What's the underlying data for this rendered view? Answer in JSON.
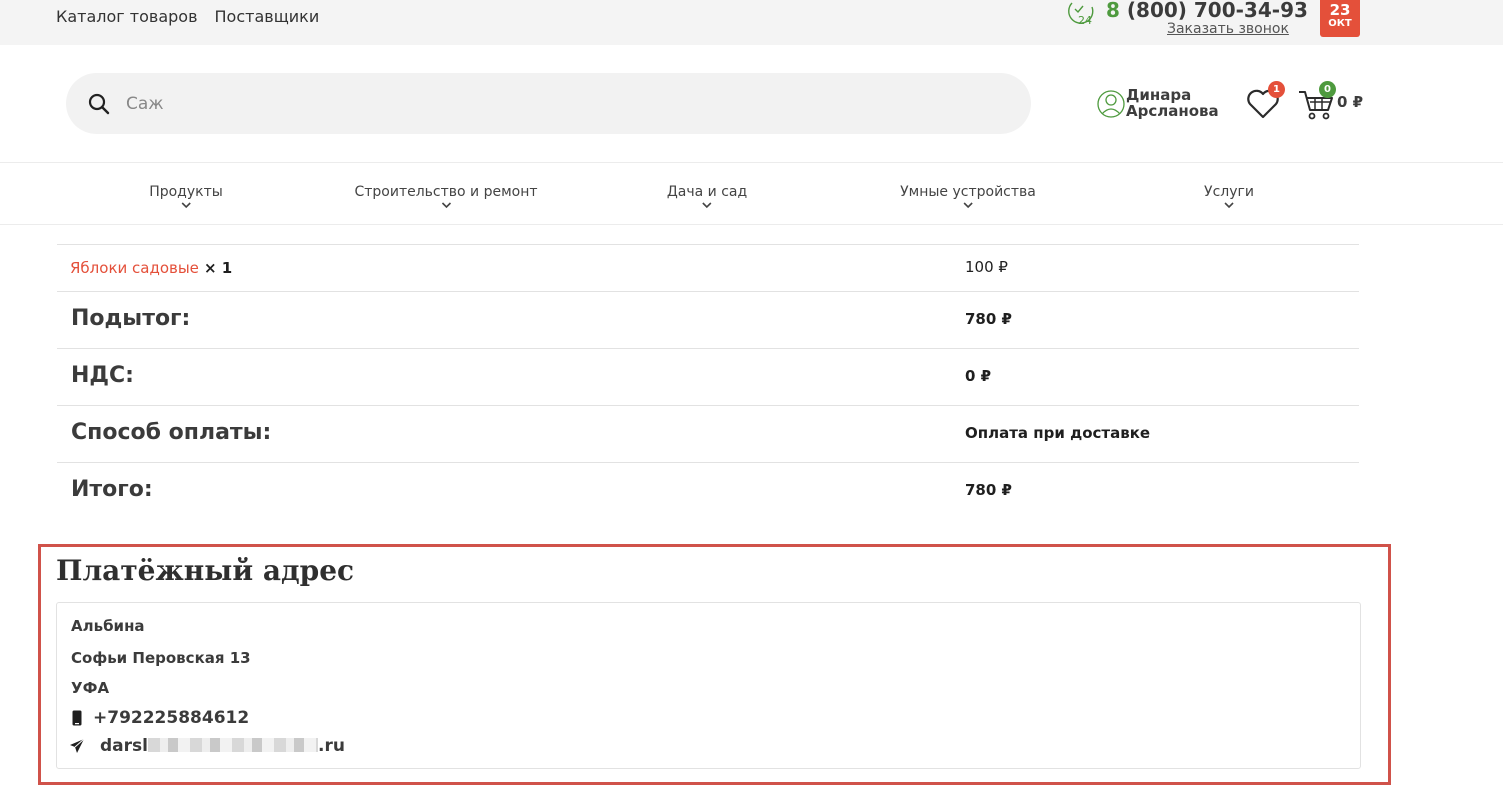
{
  "topbar": {
    "nav": [
      "Каталог товаров",
      "Поставщики"
    ],
    "phone_prefix": "8",
    "phone_number": "(800) 700-34-93",
    "callback": "Заказать звонок",
    "date_day": "23",
    "date_month": "ОКТ"
  },
  "header": {
    "search_value": "Саж",
    "user_first": "Динара",
    "user_last": "Арсланова",
    "wishlist_count": "1",
    "cart_count": "0",
    "cart_sum": "0 ₽"
  },
  "catnav": [
    "Продукты",
    "Строительство и ремонт",
    "Дача и сад",
    "Умные устройства",
    "Услуги"
  ],
  "order": {
    "product_name": "Яблоки садовые",
    "product_qty": "× 1",
    "product_price": "100 ₽",
    "rows": [
      {
        "label": "Подытог:",
        "value": "780 ₽"
      },
      {
        "label": "НДС:",
        "value": "0 ₽"
      },
      {
        "label": "Способ оплаты:",
        "value": "Оплата при доставке"
      },
      {
        "label": "Итого:",
        "value": "780 ₽"
      }
    ]
  },
  "billing": {
    "title": "Платёжный адрес",
    "name": "Альбина",
    "street": "Софьи Перовская 13",
    "city": "УФА",
    "phone": "+792225884612",
    "email_start": "darsl",
    "email_end": ".ru"
  },
  "colors": {
    "accent_red": "#e4503a",
    "accent_green": "#4e9a3e",
    "highlight_border": "#d0524a"
  }
}
